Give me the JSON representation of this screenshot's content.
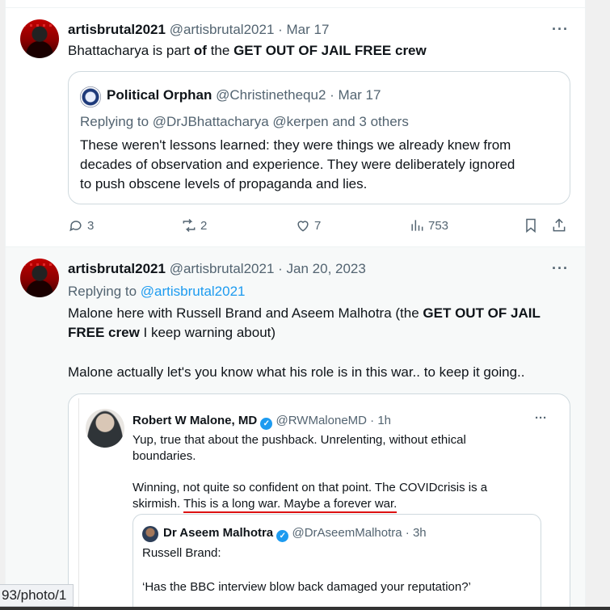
{
  "tweet1": {
    "display_name": "artisbrutal2021",
    "handle": "@artisbrutal2021",
    "date": "· Mar 17",
    "more": "···",
    "text_pre": "Bhattacharya is part ",
    "text_of": "of",
    "text_the": " the ",
    "text_bold": "GET OUT OF JAIL FREE crew",
    "quote": {
      "display_name": "Political Orphan",
      "handle": "@Christinethequ2",
      "date": "· Mar 17",
      "replying_to": "Replying to @DrJBhattacharya @kerpen and 3 others",
      "lines": [
        "These weren't lessons learned: they were things we already knew from",
        "decades of observation and experience. They were deliberately ignored",
        "to push obscene levels of propaganda and lies."
      ]
    },
    "actions": {
      "replies": "3",
      "retweets": "2",
      "likes": "7",
      "views": "753"
    }
  },
  "tweet2": {
    "display_name": "artisbrutal2021",
    "handle": "@artisbrutal2021",
    "date": "· Jan 20, 2023",
    "more": "···",
    "replying_prefix": "Replying to ",
    "replying_handle": "@artisbrutal2021",
    "line1_pre": "Malone here with Russell Brand and Aseem Malhotra (the ",
    "line1_bold": "GET OUT OF JAIL",
    "line2_bold": "FREE crew",
    "line2_post": " I keep warning about)",
    "line3": "Malone actually let's you know what his role is in this war.. to keep it going..",
    "screenshot": {
      "display_name": "Robert W Malone, MD",
      "verified": "✓",
      "handle": "@RWMaloneMD",
      "time": "· 1h",
      "more": "···",
      "p1_line1": "Yup, true that about the pushback.  Unrelenting, without ethical",
      "p1_line2": "boundaries.",
      "p2_line1": "Winning, not quite so confident on that point.  The COVIDcrisis is a",
      "p2_line2_pre": "skirmish.  ",
      "p2_line2_underlined": "This is a long war.  Maybe a forever war.",
      "inner": {
        "display_name": "Dr Aseem Malhotra",
        "verified": "✓",
        "handle": "@DrAseemMalhotra",
        "time": "· 3h",
        "line1": "Russell Brand:",
        "line2": "‘Has the BBC interview blow back damaged your reputation?’"
      }
    }
  },
  "status_bar": "93/photo/1"
}
